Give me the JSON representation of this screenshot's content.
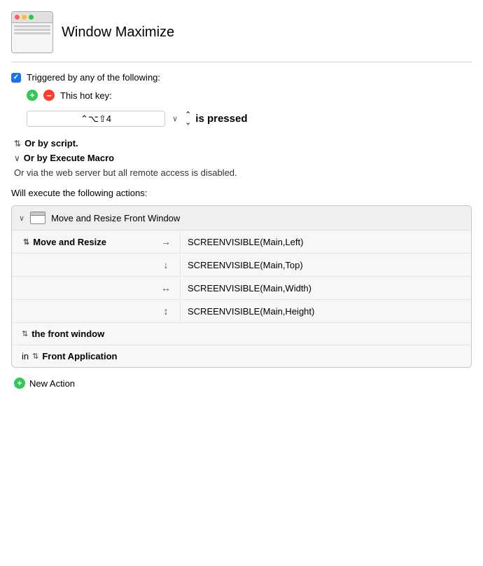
{
  "header": {
    "title": "Window Maximize"
  },
  "trigger": {
    "checkbox_label": "Triggered by any of the following:",
    "hotkey_section_label": "This hot key:",
    "hotkey_value": "⌃⌥⇧4",
    "is_pressed_label": "is pressed",
    "or_by_script_label": "Or by script.",
    "or_by_execute_label": "Or by Execute Macro",
    "web_server_label": "Or via the web server but all remote access is disabled."
  },
  "actions_section": {
    "label": "Will execute the following actions:"
  },
  "action_card": {
    "title": "Move and Resize Front Window",
    "collapse_label": "∨",
    "rows": [
      {
        "label": "Move and Resize",
        "arrow": "→",
        "value": "SCREENVISIBLE(Main,Left)"
      },
      {
        "label": "",
        "arrow": "↓",
        "value": "SCREENVISIBLE(Main,Top)"
      },
      {
        "label": "",
        "arrow": "↔",
        "value": "SCREENVISIBLE(Main,Width)"
      },
      {
        "label": "",
        "arrow": "↕",
        "value": "SCREENVISIBLE(Main,Height)"
      }
    ],
    "footer_rows": [
      {
        "label": "the front window"
      },
      {
        "label": "Front Application",
        "prefix": "in"
      }
    ]
  },
  "new_action": {
    "label": "New Action"
  }
}
